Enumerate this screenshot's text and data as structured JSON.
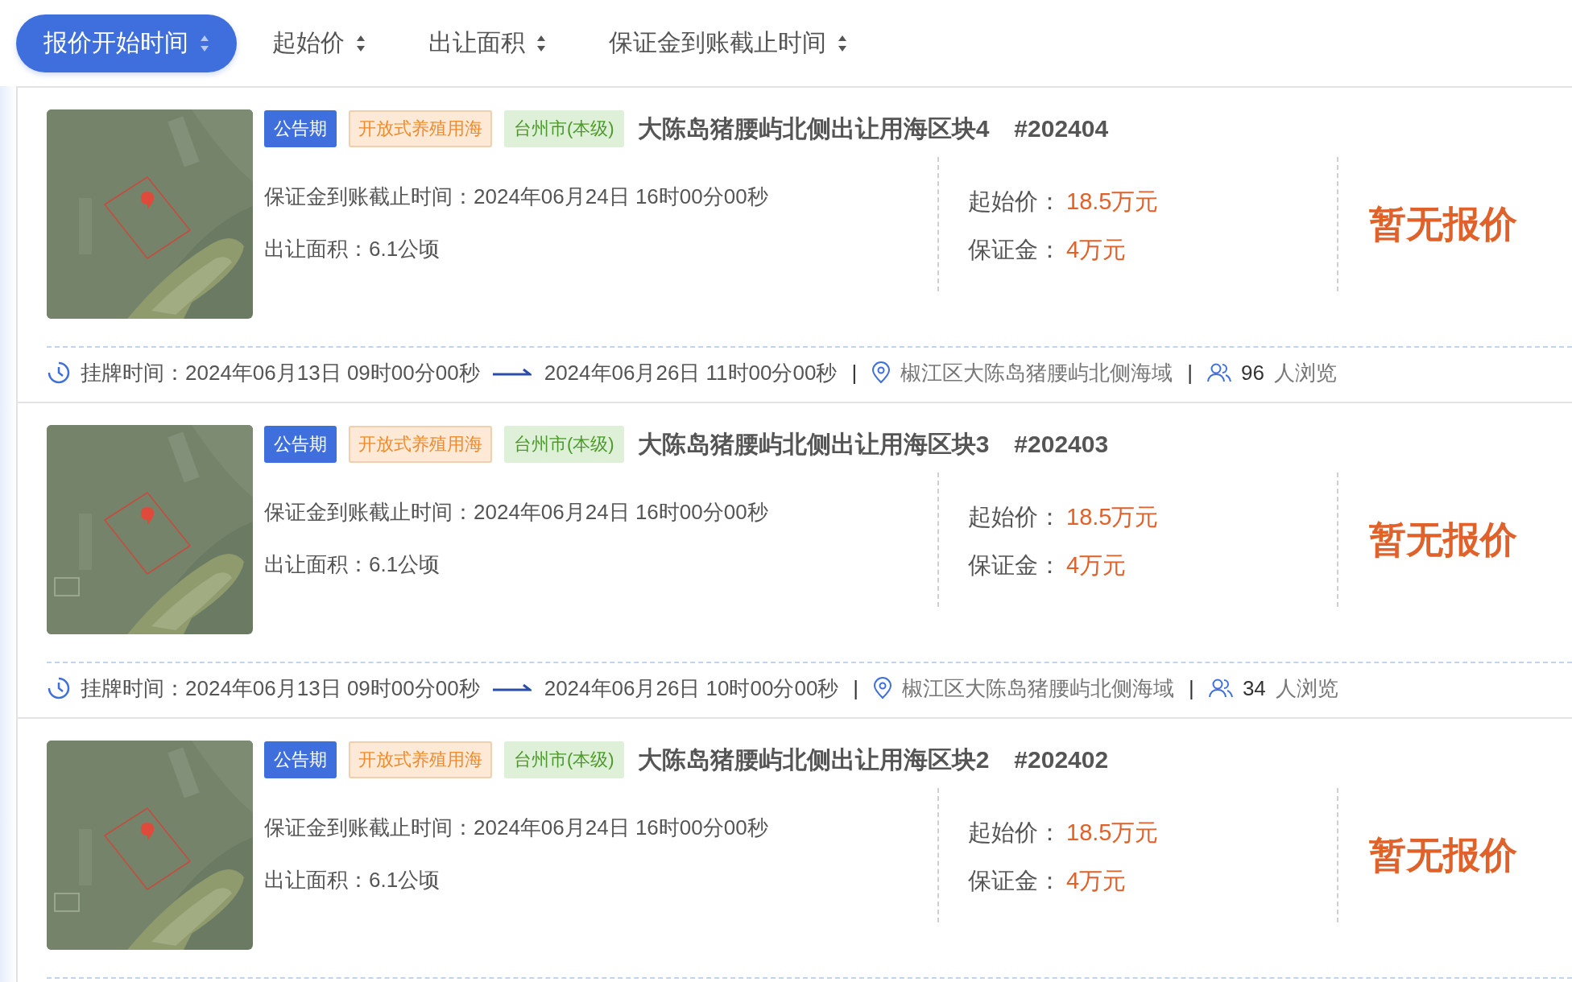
{
  "sort_options": [
    {
      "label": "报价开始时间",
      "selected": true
    },
    {
      "label": "起始价",
      "selected": false
    },
    {
      "label": "出让面积",
      "selected": false
    },
    {
      "label": "保证金到账截止时间",
      "selected": false
    }
  ],
  "listings": [
    {
      "picture": {
        "kind": "picture"
      },
      "tags": [
        {
          "label": "公告期",
          "kind": "status"
        },
        {
          "label": "开放式养殖用海",
          "kind": "usage"
        },
        {
          "label": "台州市(本级)",
          "kind": "region"
        }
      ],
      "title": "大陈岛猪腰屿北侧出让用海区块4",
      "code": "#202404",
      "deposit_deadline": "保证金到账截止时间：2024年06月24日 16时00分00秒",
      "area": "出让面积：6.1公顷",
      "start_price_label": "起始价：",
      "start_price": "18.5万元",
      "deposit_label": "保证金：",
      "deposit": "4万元",
      "bid_status": "暂无报价",
      "footer": {
        "listing_time_label": "挂牌时间：",
        "listing_start": "2024年06月13日 09时00分00秒",
        "listing_end": "2024年06月26日 11时00分00秒",
        "separator_1": "|",
        "location": "椒江区大陈岛猪腰屿北侧海域",
        "separator_2": "|",
        "views": "96",
        "views_suffix": "人浏览"
      }
    },
    {
      "picture": {
        "kind": "picture"
      },
      "tags": [
        {
          "label": "公告期",
          "kind": "status"
        },
        {
          "label": "开放式养殖用海",
          "kind": "usage"
        },
        {
          "label": "台州市(本级)",
          "kind": "region"
        }
      ],
      "title": "大陈岛猪腰屿北侧出让用海区块3",
      "code": "#202403",
      "deposit_deadline": "保证金到账截止时间：2024年06月24日 16时00分00秒",
      "area": "出让面积：6.1公顷",
      "start_price_label": "起始价：",
      "start_price": "18.5万元",
      "deposit_label": "保证金：",
      "deposit": "4万元",
      "bid_status": "暂无报价",
      "footer": {
        "listing_time_label": "挂牌时间：",
        "listing_start": "2024年06月13日 09时00分00秒",
        "listing_end": "2024年06月26日 10时00分00秒",
        "separator_1": "|",
        "location": "椒江区大陈岛猪腰屿北侧海域",
        "separator_2": "|",
        "views": "34",
        "views_suffix": "人浏览"
      }
    },
    {
      "picture": {
        "kind": "picture"
      },
      "tags": [
        {
          "label": "公告期",
          "kind": "status"
        },
        {
          "label": "开放式养殖用海",
          "kind": "usage"
        },
        {
          "label": "台州市(本级)",
          "kind": "region"
        }
      ],
      "title": "大陈岛猪腰屿北侧出让用海区块2",
      "code": "#202402",
      "deposit_deadline": "保证金到账截止时间：2024年06月24日 16时00分00秒",
      "area": "出让面积：6.1公顷",
      "start_price_label": "起始价：",
      "start_price": "18.5万元",
      "deposit_label": "保证金：",
      "deposit": "4万元",
      "bid_status": "暂无报价"
    }
  ]
}
